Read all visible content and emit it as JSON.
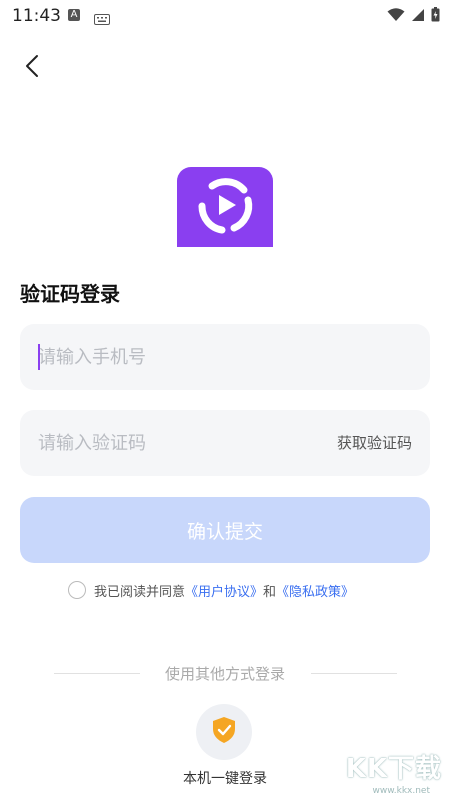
{
  "status_bar": {
    "time": "11:43",
    "a_badge": "A"
  },
  "page": {
    "title": "验证码登录"
  },
  "phone_field": {
    "placeholder": "请输入手机号",
    "value": ""
  },
  "code_field": {
    "placeholder": "请输入验证码",
    "value": "",
    "get_code_label": "获取验证码"
  },
  "confirm_button": {
    "label": "确认提交"
  },
  "agreement": {
    "prefix": "我已阅读并同意",
    "user_agreement": "《用户协议》",
    "and": "和",
    "privacy_policy": "《隐私政策》",
    "checked": false
  },
  "other_login": {
    "divider_text": "使用其他方式登录",
    "one_click_label": "本机一键登录"
  },
  "watermark": {
    "text": "KK下载",
    "url": "www.kkx.net"
  },
  "colors": {
    "brand": "#8a3ff0",
    "confirm_disabled": "#c8d7fb",
    "link": "#3a6ff0",
    "shield": "#f5a623"
  }
}
